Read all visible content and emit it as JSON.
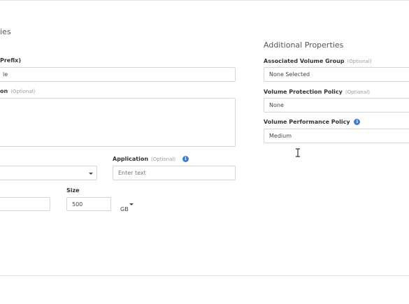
{
  "left": {
    "section_heading_fragment": "ies",
    "name_label_fragment": "Prefix)",
    "name_value_fragment": "le",
    "description_label_fragment": "on",
    "description_optional": "(Optional)",
    "description_value": "",
    "type_select_value": "",
    "application_label": "Application",
    "application_optional": "(Optional)",
    "application_placeholder": "Enter text",
    "count_value": "",
    "size_label": "Size",
    "size_value": "500",
    "size_unit": "GB"
  },
  "right": {
    "section_heading": "Additional Properties",
    "volume_group_label": "Associated Volume Group",
    "volume_group_optional": "(Optional)",
    "volume_group_value": "None Selected",
    "protection_label": "Volume Protection Policy",
    "protection_optional": "(Optional)",
    "protection_value": "None",
    "performance_label": "Volume Performance Policy",
    "performance_value": "Medium"
  },
  "icons": {
    "info": "info-circle-icon",
    "caret": "caret-down-icon",
    "cursor": "text-cursor-icon"
  },
  "colors": {
    "info_icon": "#3f7fc9",
    "border": "#d6d6d6",
    "divider": "#e4e4e4"
  }
}
